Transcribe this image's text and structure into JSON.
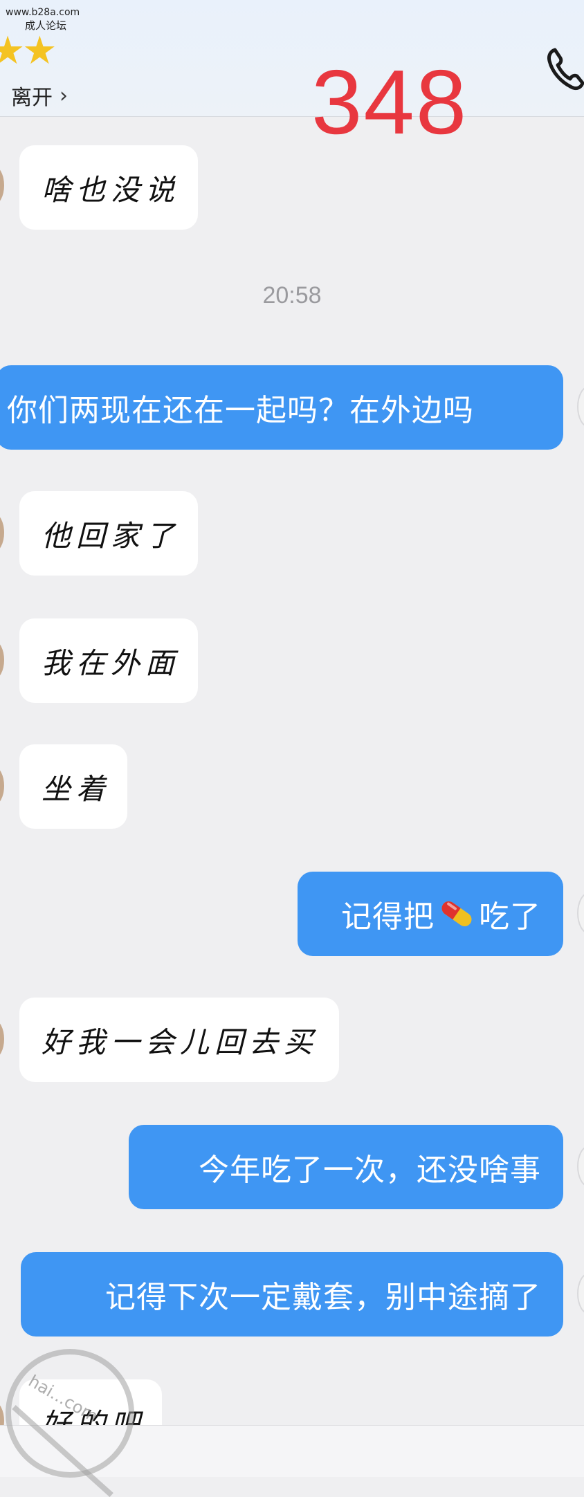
{
  "header": {
    "watermark_url": "www.b28a.com",
    "watermark_forum": "成人论坛",
    "stars": "★★",
    "leave_label": "离开",
    "chevron": "›",
    "count": "348",
    "phone_icon": "phone-icon"
  },
  "timestamp": "20:58",
  "messages": [
    {
      "dir": "in",
      "text": "啥也没说"
    },
    {
      "dir": "out",
      "text": "你们两现在还在一起吗？在外边吗"
    },
    {
      "dir": "in",
      "text": "他回家了"
    },
    {
      "dir": "in",
      "text": "我在外面"
    },
    {
      "dir": "in",
      "text": "坐着"
    },
    {
      "dir": "out",
      "text_before": "记得把",
      "text_after": "吃了",
      "emoji": "pill-icon"
    },
    {
      "dir": "in",
      "text": "好我一会儿回去买"
    },
    {
      "dir": "out",
      "text": "今年吃了一次，还没啥事"
    },
    {
      "dir": "out",
      "text": "记得下次一定戴套，别中途摘了"
    },
    {
      "dir": "in",
      "text": "好的吧"
    }
  ],
  "watermark_bottom": "hai...com",
  "colors": {
    "outgoing_bubble": "#3f96f3",
    "incoming_bubble": "#ffffff",
    "count": "#e8373f",
    "background": "#efeff1"
  }
}
